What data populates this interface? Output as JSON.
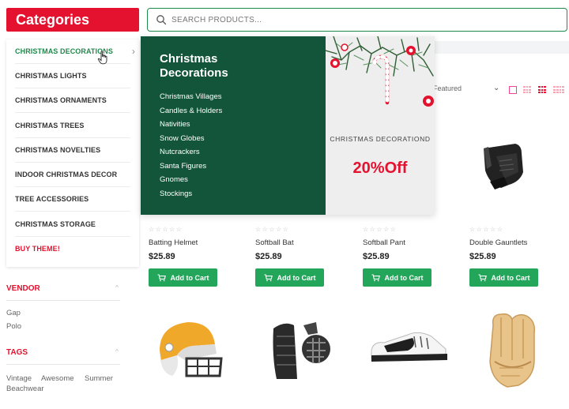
{
  "header": {
    "categories_label": "Categories",
    "search_placeholder": "SEARCH PRODUCTS..."
  },
  "categories": [
    {
      "label": "CHRISTMAS DECORATIONS",
      "active": true
    },
    {
      "label": "CHRISTMAS LIGHTS"
    },
    {
      "label": "CHRISTMAS ORNAMENTS"
    },
    {
      "label": "CHRISTMAS TREES"
    },
    {
      "label": "CHRISTMAS NOVELTIES"
    },
    {
      "label": "INDOOR CHRISTMAS DECOR"
    },
    {
      "label": "TREE ACCESSORIES"
    },
    {
      "label": "CHRISTMAS STORAGE"
    },
    {
      "label": "BUY THEME!"
    }
  ],
  "mega_menu": {
    "title": "Christmas Decorations",
    "links": [
      "Christmas Villages",
      "Candles & Holders",
      "Nativities",
      "Snow Globes",
      "Nutcrackers",
      "Santa Figures",
      "Gnomes",
      "Stockings"
    ],
    "promo_subtitle": "CHRISTMAS DECORATIOND",
    "promo_offer": "20%Off"
  },
  "toolbar": {
    "sort_label": "Featured"
  },
  "products": [
    {
      "name": "Batting Helmet",
      "price": "$25.89",
      "cart_label": "Add to Cart",
      "rating": 0
    },
    {
      "name": "Softball Bat",
      "price": "$25.89",
      "cart_label": "Add to Cart",
      "rating": 0
    },
    {
      "name": "Softball Pant",
      "price": "$25.89",
      "cart_label": "Add to Cart",
      "rating": 0
    },
    {
      "name": "Double Gauntlets",
      "price": "$25.89",
      "cart_label": "Add to Cart",
      "rating": 0
    }
  ],
  "sidebar": {
    "vendor_title": "VENDOR",
    "vendors": [
      "Gap",
      "Polo"
    ],
    "tags_title": "TAGS",
    "tags": [
      "Vintage",
      "Awesome",
      "Summer",
      "Beachwear"
    ]
  },
  "colors": {
    "brand_red": "#e4112f",
    "brand_green": "#23a55a",
    "menu_green": "#13553a"
  }
}
